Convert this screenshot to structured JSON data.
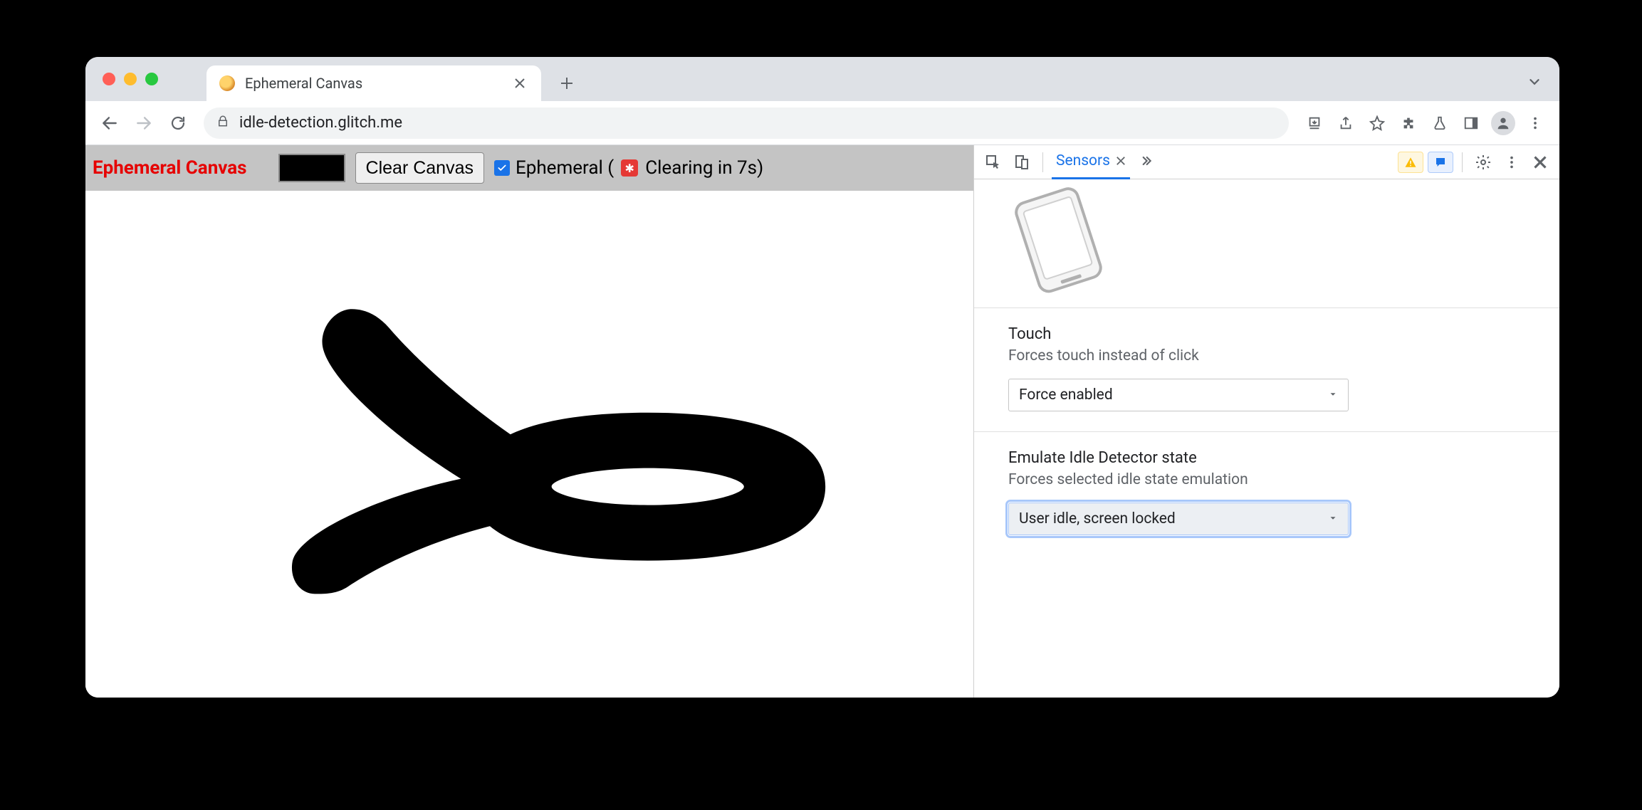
{
  "browser": {
    "tab_title": "Ephemeral Canvas",
    "url": "idle-detection.glitch.me"
  },
  "page": {
    "title": "Ephemeral Canvas",
    "clear_button": "Clear Canvas",
    "ephemeral_label_prefix": "Ephemeral (",
    "ephemeral_label_suffix": " Clearing in 7s)",
    "ephemeral_checked": true
  },
  "devtools": {
    "active_tab": "Sensors",
    "sections": [
      {
        "title": "Touch",
        "subtitle": "Forces touch instead of click",
        "value": "Force enabled"
      },
      {
        "title": "Emulate Idle Detector state",
        "subtitle": "Forces selected idle state emulation",
        "value": "User idle, screen locked"
      }
    ]
  }
}
